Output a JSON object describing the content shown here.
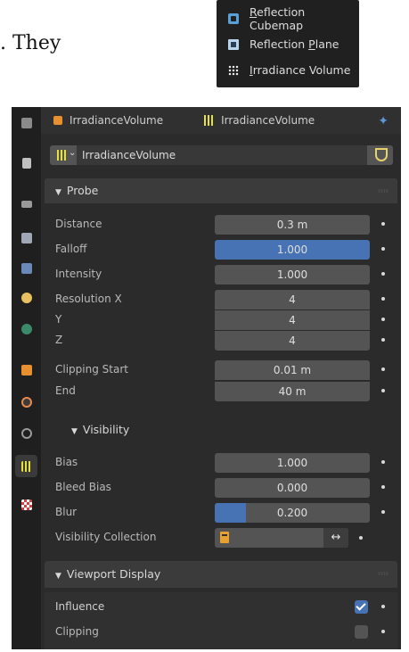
{
  "snippet_text": ". They",
  "add_menu": {
    "items": [
      {
        "label": "Reflection Cubemap",
        "icon": "reflection-cubemap-icon"
      },
      {
        "label": "Reflection Plane",
        "icon": "reflection-plane-icon"
      },
      {
        "label": "Irradiance Volume",
        "icon": "irradiance-volume-icon"
      }
    ]
  },
  "header": {
    "object_name": "IrradianceVolume",
    "data_name": "IrradianceVolume"
  },
  "datablock": {
    "name": "IrradianceVolume"
  },
  "probe": {
    "title": "Probe",
    "distance": {
      "label": "Distance",
      "value": "0.3 m"
    },
    "falloff": {
      "label": "Falloff",
      "value": "1.000"
    },
    "intensity": {
      "label": "Intensity",
      "value": "1.000"
    },
    "resolution_x": {
      "label": "Resolution X",
      "value": "4"
    },
    "resolution_y": {
      "label": "Y",
      "value": "4"
    },
    "resolution_z": {
      "label": "Z",
      "value": "4"
    },
    "clipping_start": {
      "label": "Clipping Start",
      "value": "0.01 m"
    },
    "clipping_end": {
      "label": "End",
      "value": "40 m"
    }
  },
  "visibility": {
    "title": "Visibility",
    "bias": {
      "label": "Bias",
      "value": "1.000"
    },
    "bleed_bias": {
      "label": "Bleed Bias",
      "value": "0.000"
    },
    "blur": {
      "label": "Blur",
      "value": "0.200",
      "fraction": 0.2
    },
    "collection": {
      "label": "Visibility Collection"
    }
  },
  "viewport_display": {
    "title": "Viewport Display",
    "influence": {
      "label": "Influence",
      "checked": true
    },
    "clipping": {
      "label": "Clipping",
      "checked": false
    }
  },
  "colors": {
    "accent": "#4772b3",
    "irradiance_icon": "#e8e03a",
    "object_icon": "#e89030"
  }
}
